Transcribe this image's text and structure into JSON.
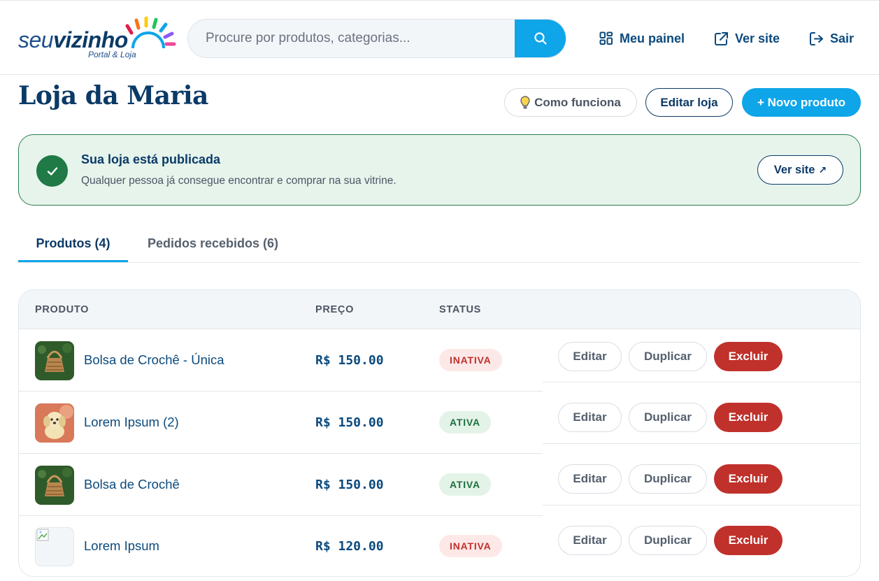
{
  "header": {
    "logo": {
      "word_part1": "seu",
      "word_part2": "vizinho",
      "tagline": "Portal & Loja"
    },
    "search": {
      "placeholder": "Procure por produtos, categorias...",
      "icon": "search-icon"
    },
    "nav": [
      {
        "label": "Meu painel",
        "icon": "dashboard-grid-icon"
      },
      {
        "label": "Ver site",
        "icon": "external-link-icon"
      },
      {
        "label": "Sair",
        "icon": "logout-icon"
      }
    ]
  },
  "page": {
    "title": "Loja da Maria",
    "buttons": {
      "how_it_works": "Como funciona",
      "edit_store": "Editar loja",
      "new_product": "+ Novo produto"
    }
  },
  "banner": {
    "title": "Sua loja está publicada",
    "subtitle": "Qualquer pessoa já consegue encontrar e comprar na sua vitrine.",
    "button": "Ver site",
    "button_icon": "↗"
  },
  "tabs": [
    {
      "label": "Produtos (4)",
      "active": true
    },
    {
      "label": "Pedidos recebidos (6)",
      "active": false
    }
  ],
  "table": {
    "columns": [
      "PRODUTO",
      "PREÇO",
      "STATUS"
    ],
    "actions": {
      "edit": "Editar",
      "duplicate": "Duplicar",
      "delete": "Excluir"
    },
    "rows": [
      {
        "name": "Bolsa de Crochê - Única",
        "price": "R$ 150.00",
        "status": "INATIVA",
        "thumb": "crochet-bag"
      },
      {
        "name": "Lorem Ipsum (2)",
        "price": "R$ 150.00",
        "status": "ATIVA",
        "thumb": "plush-toy"
      },
      {
        "name": "Bolsa de Crochê",
        "price": "R$ 150.00",
        "status": "ATIVA",
        "thumb": "crochet-bag"
      },
      {
        "name": "Lorem Ipsum",
        "price": "R$ 120.00",
        "status": "INATIVA",
        "thumb": "broken-image"
      }
    ]
  },
  "colors": {
    "primary_blue": "#0b3a66",
    "accent_sky": "#0ea5e9",
    "success_green": "#1f7a45",
    "danger_red": "#c0312b"
  }
}
